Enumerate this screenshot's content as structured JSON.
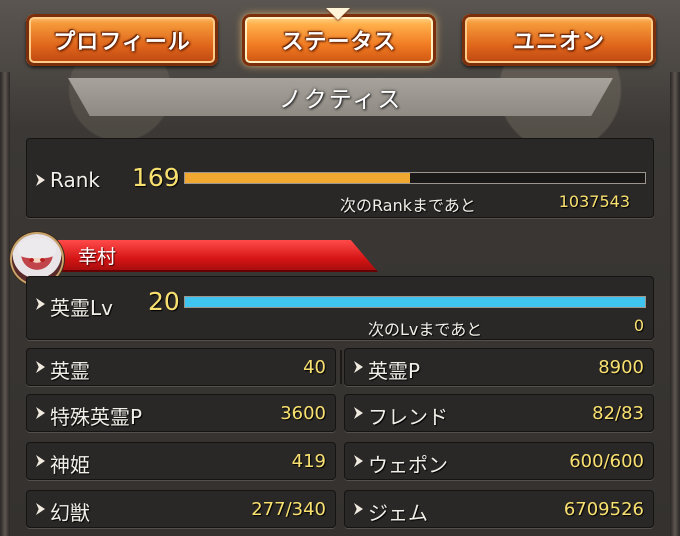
{
  "tabs": [
    {
      "label": "プロフィール",
      "active": false
    },
    {
      "label": "ステータス",
      "active": true
    },
    {
      "label": "ユニオン",
      "active": false
    }
  ],
  "header": {
    "name": "ノクティス"
  },
  "rank": {
    "label": "Rank",
    "value": "169",
    "progress_fraction": 0.49,
    "next_label": "次のRankまであと",
    "next_value": "1037543",
    "bar_color": "#f0a830"
  },
  "hero": {
    "name": "幸村",
    "level_label": "英霊Lv",
    "level_value": "20",
    "progress_fraction": 1.0,
    "next_label": "次のLvまであと",
    "next_value": "0",
    "bar_color": "#3fc4f0"
  },
  "stats_left": [
    {
      "label": "英霊",
      "value": "40"
    },
    {
      "label": "特殊英霊P",
      "value": "3600"
    },
    {
      "label": "神姫",
      "value": "419"
    },
    {
      "label": "幻獣",
      "value": "277/340"
    }
  ],
  "stats_right": [
    {
      "label": "英霊P",
      "value": "8900"
    },
    {
      "label": "フレンド",
      "value": "82/83"
    },
    {
      "label": "ウェポン",
      "value": "600/600"
    },
    {
      "label": "ジェム",
      "value": "6709526"
    }
  ],
  "icons": {
    "row_marker": "chevron-right-icon",
    "avatar": "character-portrait"
  }
}
